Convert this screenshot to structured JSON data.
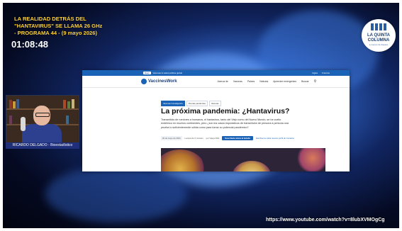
{
  "overlay": {
    "title_lines": [
      "LA REALIDAD DETRÁS DEL",
      "\"HANTAVIRUS\" SE LLAMA 26 GHz",
      "- PROGRAMA 44 - (9 mayo 2026)"
    ],
    "timer": "01:08:48",
    "logo_line1": "LA QUINTA",
    "logo_line2": "COLUMNA",
    "logo_tagline": "a cuerpo de disparo",
    "speaker_caption": "RICARDO DELGADO - Bioestadístico",
    "source_url": "https://www.youtube.com/watch?v=8lubXVMOgCg"
  },
  "website": {
    "topbar_brand": "Gavi",
    "topbar_text": "Vacunas & salud pública global",
    "topbar_links": [
      "Ingles",
      "Francés"
    ],
    "brand": "VaccinesWork",
    "nav_items": [
      "Acerca de",
      "Vacunas",
      "Países",
      "Noticias",
      "Aprender emergentes",
      "Buscar"
    ],
    "tags": [
      "Vacunas Investigación",
      "Puertas pandemias",
      "Vacunas"
    ],
    "headline": "La próxima pandemia: ¿Hantavirus?",
    "lead": "Transmitido de roedores a humanos, el hantavirus, tanto del Viejo como del Nuevo Mundo, se ha vuelto endémico en muchos continentes, pero ¿son los casos esporádicos de transmisión de persona a persona una prueba lo suficientemente sólida como para tomar su potencial pandémico?",
    "date": "20 de mayo de 2024",
    "read_time": "Lectura de 6 minutos",
    "author": "por Vijaya Patil",
    "cta": "Suscríbete ahora al boletín",
    "link": "Escríbenos visita nuestro perfil de Contacto"
  },
  "colors": {
    "title_yellow": "#ffd33a",
    "gavi_blue": "#1b63b7",
    "caption_blue": "#1f2f7a"
  }
}
